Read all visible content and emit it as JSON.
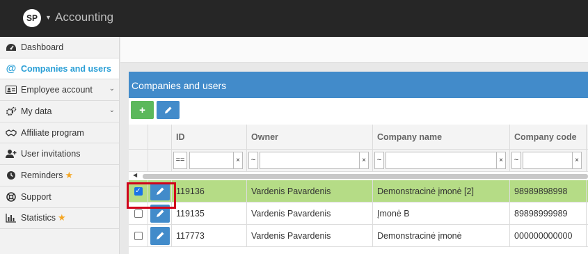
{
  "app": {
    "logo": "SP",
    "title": "Accounting"
  },
  "sidebar": {
    "items": [
      {
        "label": "Dashboard",
        "icon": "dashboard-icon"
      },
      {
        "label": "Companies and users",
        "icon": "at-icon",
        "active": true
      },
      {
        "label": "Employee account",
        "icon": "id-card-icon",
        "expandable": true
      },
      {
        "label": "My data",
        "icon": "gears-icon",
        "expandable": true
      },
      {
        "label": "Affiliate program",
        "icon": "handshake-icon"
      },
      {
        "label": "User invitations",
        "icon": "user-plus-icon"
      },
      {
        "label": "Reminders",
        "icon": "clock-icon",
        "star": true
      },
      {
        "label": "Support",
        "icon": "life-ring-icon"
      },
      {
        "label": "Statistics",
        "icon": "bar-chart-icon",
        "star": true
      }
    ]
  },
  "panel": {
    "title": "Companies and users",
    "add_button": "+",
    "columns": {
      "id": "ID",
      "owner": "Owner",
      "company_name": "Company name",
      "company_code": "Company code"
    },
    "filters": {
      "id_op": "==",
      "owner_op": "~",
      "name_op": "~",
      "code_op": "~",
      "clear": "×"
    },
    "rows": [
      {
        "id": "119136",
        "owner": "Vardenis Pavardenis",
        "company_name": "Demonstracinė įmonė [2]",
        "company_code": "98989898998",
        "checked": true
      },
      {
        "id": "119135",
        "owner": "Vardenis Pavardenis",
        "company_name": "Įmonė B",
        "company_code": "89898999989",
        "checked": false
      },
      {
        "id": "117773",
        "owner": "Vardenis Pavardenis",
        "company_name": "Demonstracinė įmonė",
        "company_code": "000000000000",
        "checked": false
      }
    ]
  },
  "colors": {
    "accent": "#428bca",
    "selected_row": "#b5dc86",
    "active_nav": "#2a9fd6",
    "star": "#f5a623",
    "highlight": "#d0021b"
  }
}
